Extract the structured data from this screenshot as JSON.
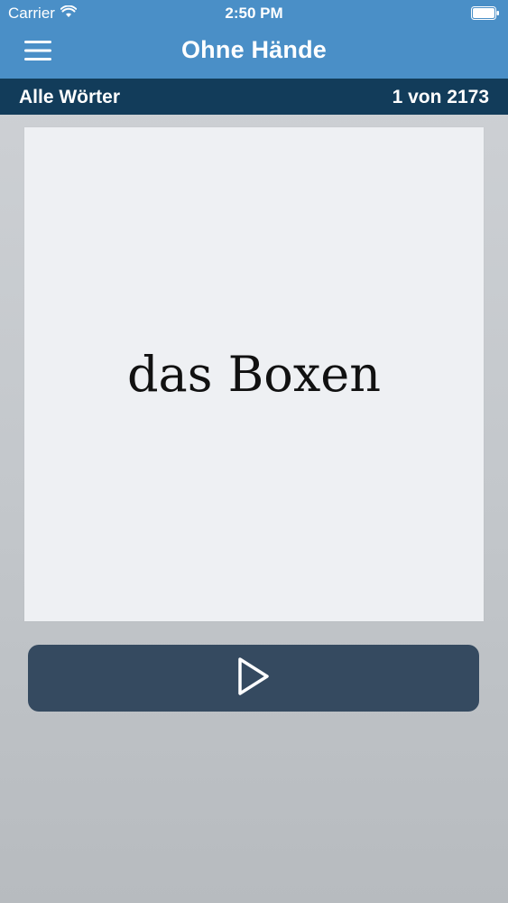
{
  "status_bar": {
    "carrier": "Carrier",
    "time": "2:50 PM"
  },
  "nav": {
    "title": "Ohne Hände"
  },
  "subbar": {
    "list_name": "Alle Wörter",
    "progress": "1 von 2173"
  },
  "card": {
    "word": "das Boxen"
  },
  "icons": {
    "menu": "hamburger-menu-icon",
    "play": "play-icon",
    "wifi": "wifi-icon",
    "battery": "battery-icon"
  },
  "colors": {
    "header": "#4a8fc7",
    "subbar": "#123c5a",
    "play_button": "#354a60",
    "card": "#eef0f3"
  }
}
